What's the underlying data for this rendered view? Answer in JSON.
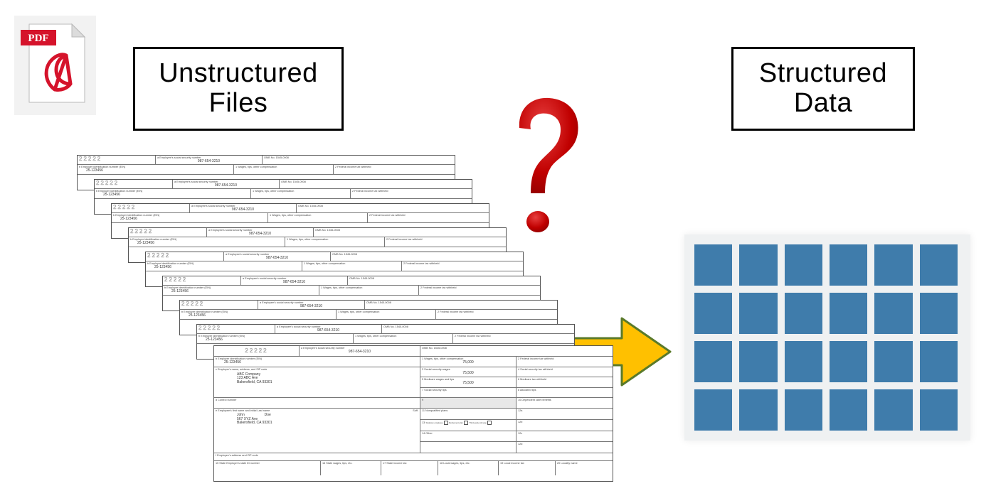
{
  "labels": {
    "unstructured_line1": "Unstructured",
    "unstructured_line2": "Files",
    "structured_line1": "Structured",
    "structured_line2": "Data"
  },
  "pdf_badge": "PDF",
  "question_mark": "?",
  "form": {
    "box_a": "22222",
    "ssn_label": "a  Employee's social security number",
    "ssn": "987-654-3210",
    "omb": "OMB No. 1545-0008",
    "ein_label": "b  Employer identification number (EIN)",
    "ein": "25-123456",
    "box1_label": "1  Wages, tips, other compensation",
    "box1": "75,000",
    "box2_label": "2  Federal income tax withheld",
    "employer_label": "c  Employer's name, address, and ZIP code",
    "employer_name": "ABC Company",
    "employer_addr1": "123 ABC Ave",
    "employer_addr2": "Bakersfield, CA 93301",
    "box3_label": "3  Social security wages",
    "box3": "75,500",
    "box4_label": "4  Social security tax withheld",
    "box5_label": "5  Medicare wages and tips",
    "box5": "75,500",
    "box6_label": "6  Medicare tax withheld",
    "box7_label": "7  Social security tips",
    "box8_label": "8  Allocated tips",
    "control_label": "d  Control number",
    "box9_label": "9",
    "box10_label": "10  Dependent care benefits",
    "emp_name_label": "e  Employee's first name and initial        Last name",
    "suff": "Suff.",
    "emp_first": "John",
    "emp_last": "Doe",
    "emp_addr1": "567 XYZ Ave",
    "emp_addr2": "Bakersfield, CA 93301",
    "box11_label": "11  Nonqualified plans",
    "box12a": "12a",
    "box12b": "12b",
    "box12c": "12c",
    "box12d": "12d",
    "box13_label": "13",
    "box13_a": "Statutory employee",
    "box13_b": "Retirement plan",
    "box13_c": "Third-party sick pay",
    "box14_label": "14  Other",
    "empaddr_label": "f  Employee's address and ZIP code",
    "b15_label": "15  State   Employer's state ID number",
    "b16_label": "16  State wages, tips, etc.",
    "b17_label": "17  State income tax",
    "b18_label": "18  Local wages, tips, etc.",
    "b19_label": "19  Local income tax",
    "b20_label": "20  Locality name"
  },
  "grid": {
    "rows": 4,
    "cols": 6
  },
  "colors": {
    "question": "#c00000",
    "arrow_fill": "#ffc000",
    "arrow_stroke": "#5a7a2a",
    "grid_cell": "#3f7cab",
    "grid_bg": "#eff1f2",
    "pdf_red": "#d5132b"
  }
}
